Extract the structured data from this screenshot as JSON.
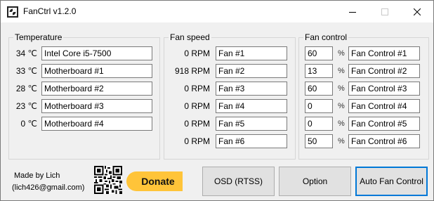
{
  "window": {
    "title": "FanCtrl v1.2.0"
  },
  "temperature": {
    "title": "Temperature",
    "rows": [
      {
        "value": "34 ℃",
        "name": "Intel Core i5-7500"
      },
      {
        "value": "33 ℃",
        "name": "Motherboard #1"
      },
      {
        "value": "28 ℃",
        "name": "Motherboard #2"
      },
      {
        "value": "23 ℃",
        "name": "Motherboard #3"
      },
      {
        "value": "0 ℃",
        "name": "Motherboard #4"
      }
    ]
  },
  "fan_speed": {
    "title": "Fan speed",
    "rows": [
      {
        "value": "0 RPM",
        "name": "Fan #1"
      },
      {
        "value": "918 RPM",
        "name": "Fan #2"
      },
      {
        "value": "0 RPM",
        "name": "Fan #3"
      },
      {
        "value": "0 RPM",
        "name": "Fan #4"
      },
      {
        "value": "0 RPM",
        "name": "Fan #5"
      },
      {
        "value": "0 RPM",
        "name": "Fan #6"
      }
    ]
  },
  "fan_control": {
    "title": "Fan control",
    "unit": "%",
    "rows": [
      {
        "value": "60",
        "name": "Fan Control #1"
      },
      {
        "value": "13",
        "name": "Fan Control #2"
      },
      {
        "value": "60",
        "name": "Fan Control #3"
      },
      {
        "value": "0",
        "name": "Fan Control #4"
      },
      {
        "value": "0",
        "name": "Fan Control #5"
      },
      {
        "value": "50",
        "name": "Fan Control #6"
      }
    ]
  },
  "footer": {
    "made_by": "Made by Lich",
    "email": "(lich426@gmail.com)",
    "donate_label": "Donate",
    "osd_label": "OSD (RTSS)",
    "option_label": "Option",
    "auto_label": "Auto Fan Control"
  },
  "icons": {
    "app": "fan-app-icon",
    "minimize": "minimize-icon",
    "maximize": "maximize-icon",
    "close": "close-icon",
    "qr": "qr-code-icon"
  },
  "colors": {
    "window_bg": "#f0f0f0",
    "titlebar_bg": "#ffffff",
    "donate_bg": "#ffc439",
    "focus_border": "#0078d7"
  }
}
